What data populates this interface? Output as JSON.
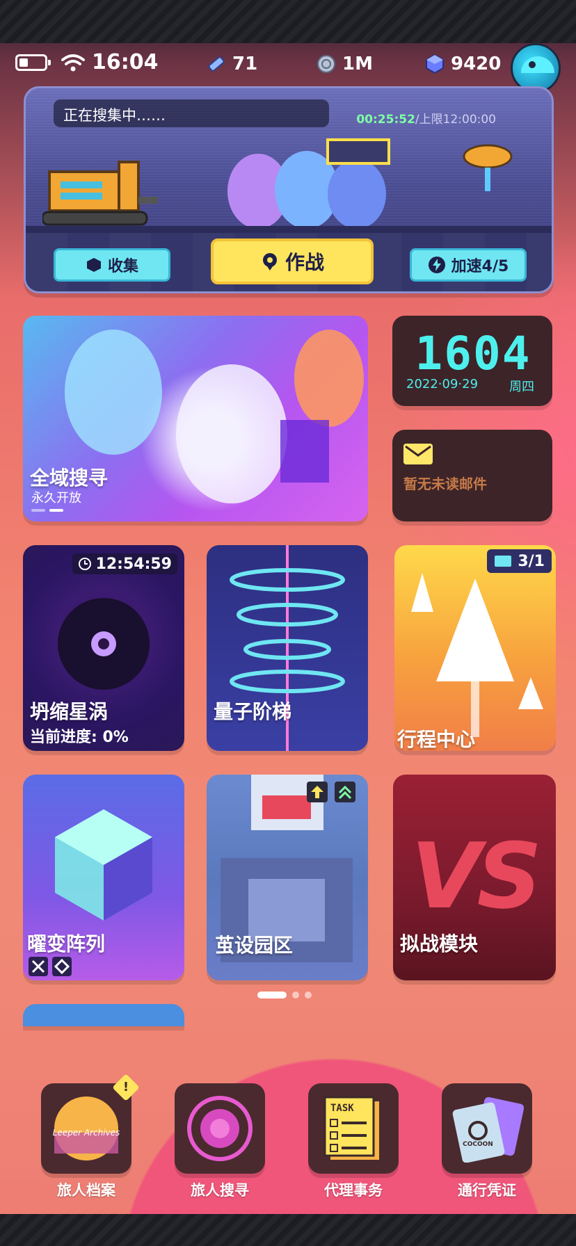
{
  "status_bar": {
    "time": "16:04",
    "energy_count": "71",
    "coin_count": "1M",
    "gem_count": "9420"
  },
  "gathering": {
    "status_text": "正在搜集中……",
    "elapsed": "00:25:52",
    "limit": "/上限12:00:00",
    "collect_label": "收集",
    "battle_label": "作战",
    "speed_label": "加速4/5"
  },
  "banner": {
    "title": "全域搜寻",
    "subtitle": "永久开放"
  },
  "clock": {
    "time": "1604",
    "date": "2022·09·29",
    "weekday": "周四"
  },
  "mail": {
    "text": "暂无未读邮件"
  },
  "tiles": {
    "collapse": {
      "timer": "12:54:59",
      "title": "坍缩星涡",
      "progress": "当前进度:  0%"
    },
    "quantum": {
      "title": "量子阶梯"
    },
    "itinerary": {
      "count": "3/1",
      "title": "行程中心"
    },
    "matrix": {
      "title": "曜变阵列"
    },
    "park": {
      "title": "茧设园区"
    },
    "vs": {
      "title": "拟战模块",
      "art_text": "VS"
    }
  },
  "pager": {
    "pages": 3,
    "active": 1
  },
  "dock": {
    "archive": "旅人档案",
    "search": "旅人搜寻",
    "tasks": "代理事务",
    "pass": "通行凭证",
    "tasks_icon_text": "TASK",
    "pass_icon_text": "COCOON",
    "archive_icon_text": "Leeper Archives"
  },
  "colors": {
    "accent_cyan": "#4ef0ee",
    "accent_yellow": "#ffe45e",
    "panel_brown": "#3d2428",
    "dock_brown": "#4a2a2f"
  },
  "icons": {
    "battery": "battery-icon",
    "wifi": "wifi-icon",
    "energy": "energy-icon",
    "coin": "coin-icon",
    "gem": "gem-icon",
    "collect": "cube-icon",
    "battle": "location-pin-icon",
    "speed": "lightning-icon",
    "mail": "envelope-icon",
    "timer": "clock-icon"
  }
}
